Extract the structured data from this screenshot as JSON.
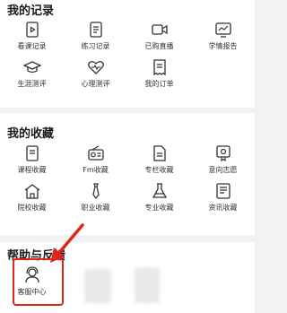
{
  "records": {
    "title": "我的记录",
    "items": [
      {
        "label": "看课记录",
        "icon": "play-doc-icon"
      },
      {
        "label": "练习记录",
        "icon": "practice-doc-icon"
      },
      {
        "label": "已购直播",
        "icon": "video-camera-icon"
      },
      {
        "label": "学情报告",
        "icon": "chart-report-icon"
      },
      {
        "label": "生涯测评",
        "icon": "graduation-cap-icon"
      },
      {
        "label": "心理测评",
        "icon": "heart-pulse-icon"
      },
      {
        "label": "我的订单",
        "icon": "receipt-icon"
      }
    ]
  },
  "favorites": {
    "title": "我的收藏",
    "items": [
      {
        "label": "课程收藏",
        "icon": "course-doc-icon"
      },
      {
        "label": "Fm收藏",
        "icon": "radio-icon"
      },
      {
        "label": "专栏收藏",
        "icon": "column-doc-icon"
      },
      {
        "label": "意向志愿",
        "icon": "certificate-icon"
      },
      {
        "label": "院校收藏",
        "icon": "school-building-icon"
      },
      {
        "label": "职业收藏",
        "icon": "necktie-icon"
      },
      {
        "label": "专业收藏",
        "icon": "flask-icon"
      },
      {
        "label": "资讯收藏",
        "icon": "news-doc-icon"
      }
    ]
  },
  "help": {
    "title": "帮助与反馈",
    "items": [
      {
        "label": "客服中心",
        "icon": "headset-agent-icon"
      }
    ]
  },
  "colors": {
    "accent": "#e0261c",
    "icon_stroke": "#333333",
    "background": "#f2f2f2"
  }
}
